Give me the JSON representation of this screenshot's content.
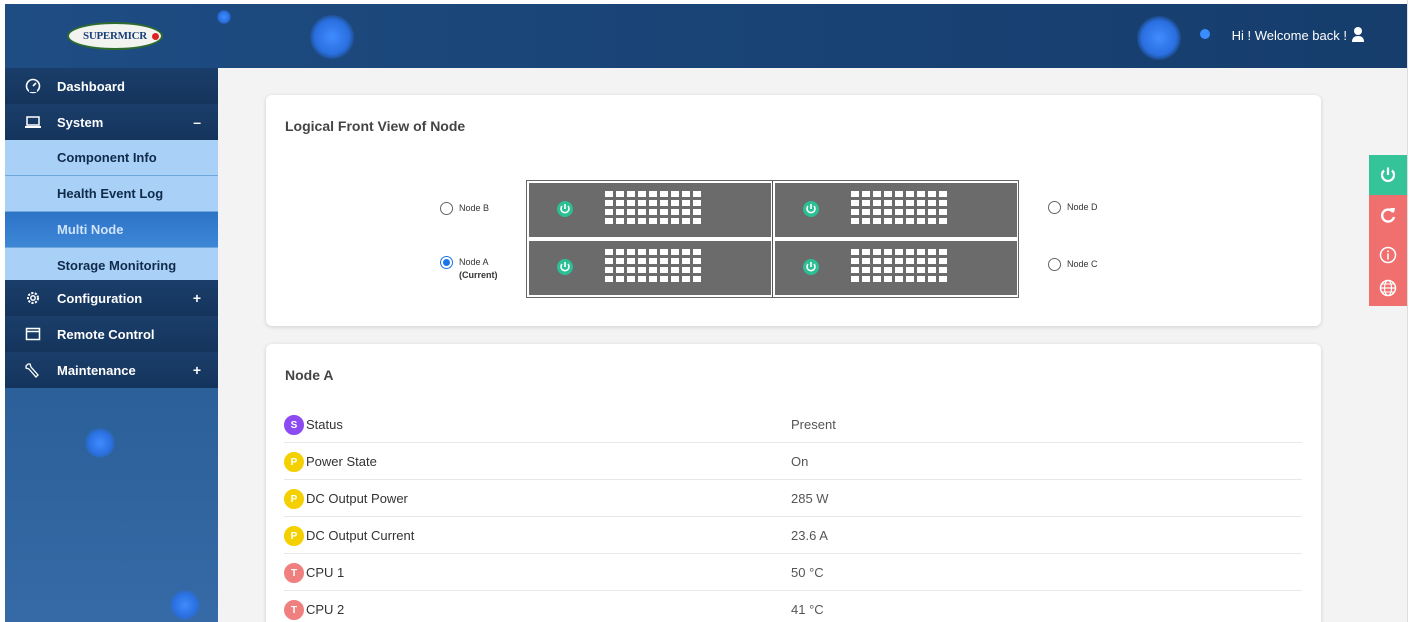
{
  "header": {
    "brand": "SUPERMICR",
    "welcome": "Hi ! Welcome back !"
  },
  "sidebar": {
    "items": [
      {
        "label": "Dashboard",
        "icon": "dashboard-gauge-icon"
      },
      {
        "label": "System",
        "icon": "laptop-icon",
        "sign": "–"
      },
      {
        "label": "Component Info"
      },
      {
        "label": "Health Event Log"
      },
      {
        "label": "Multi Node",
        "active": true
      },
      {
        "label": "Storage Monitoring"
      },
      {
        "label": "Configuration",
        "icon": "gear-icon",
        "sign": "+"
      },
      {
        "label": "Remote Control",
        "icon": "window-icon"
      },
      {
        "label": "Maintenance",
        "icon": "wrench-icon",
        "sign": "+"
      }
    ]
  },
  "front_view": {
    "title": "Logical Front View of Node",
    "nodes": {
      "b": {
        "label": "Node B",
        "selected": false
      },
      "a": {
        "label": "Node A",
        "sub": "(Current)",
        "selected": true
      },
      "d": {
        "label": "Node D",
        "selected": false
      },
      "c": {
        "label": "Node C",
        "selected": false
      }
    }
  },
  "node_detail": {
    "title": "Node A",
    "rows": [
      {
        "badge": "S",
        "label": "Status",
        "value": "Present",
        "color": "#8c4bf0"
      },
      {
        "badge": "P",
        "label": "Power State",
        "value": "On",
        "color": "#f5d000"
      },
      {
        "badge": "P",
        "label": "DC Output Power",
        "value": "285 W",
        "color": "#f5d000"
      },
      {
        "badge": "P",
        "label": "DC Output Current",
        "value": "23.6 A",
        "color": "#f5d000"
      },
      {
        "badge": "T",
        "label": "CPU 1",
        "value": "50 °C",
        "color": "#f08080"
      },
      {
        "badge": "T",
        "label": "CPU 2",
        "value": "41 °C",
        "color": "#f08080"
      }
    ]
  },
  "side_actions": [
    {
      "icon": "power-icon",
      "color": "#35c49a"
    },
    {
      "icon": "refresh-icon",
      "color": "#f07070"
    },
    {
      "icon": "info-icon",
      "color": "#f07070"
    },
    {
      "icon": "globe-icon",
      "color": "#f07070"
    }
  ],
  "colors": {
    "accent": "#1f4e82",
    "power_green": "#2bbf93"
  }
}
